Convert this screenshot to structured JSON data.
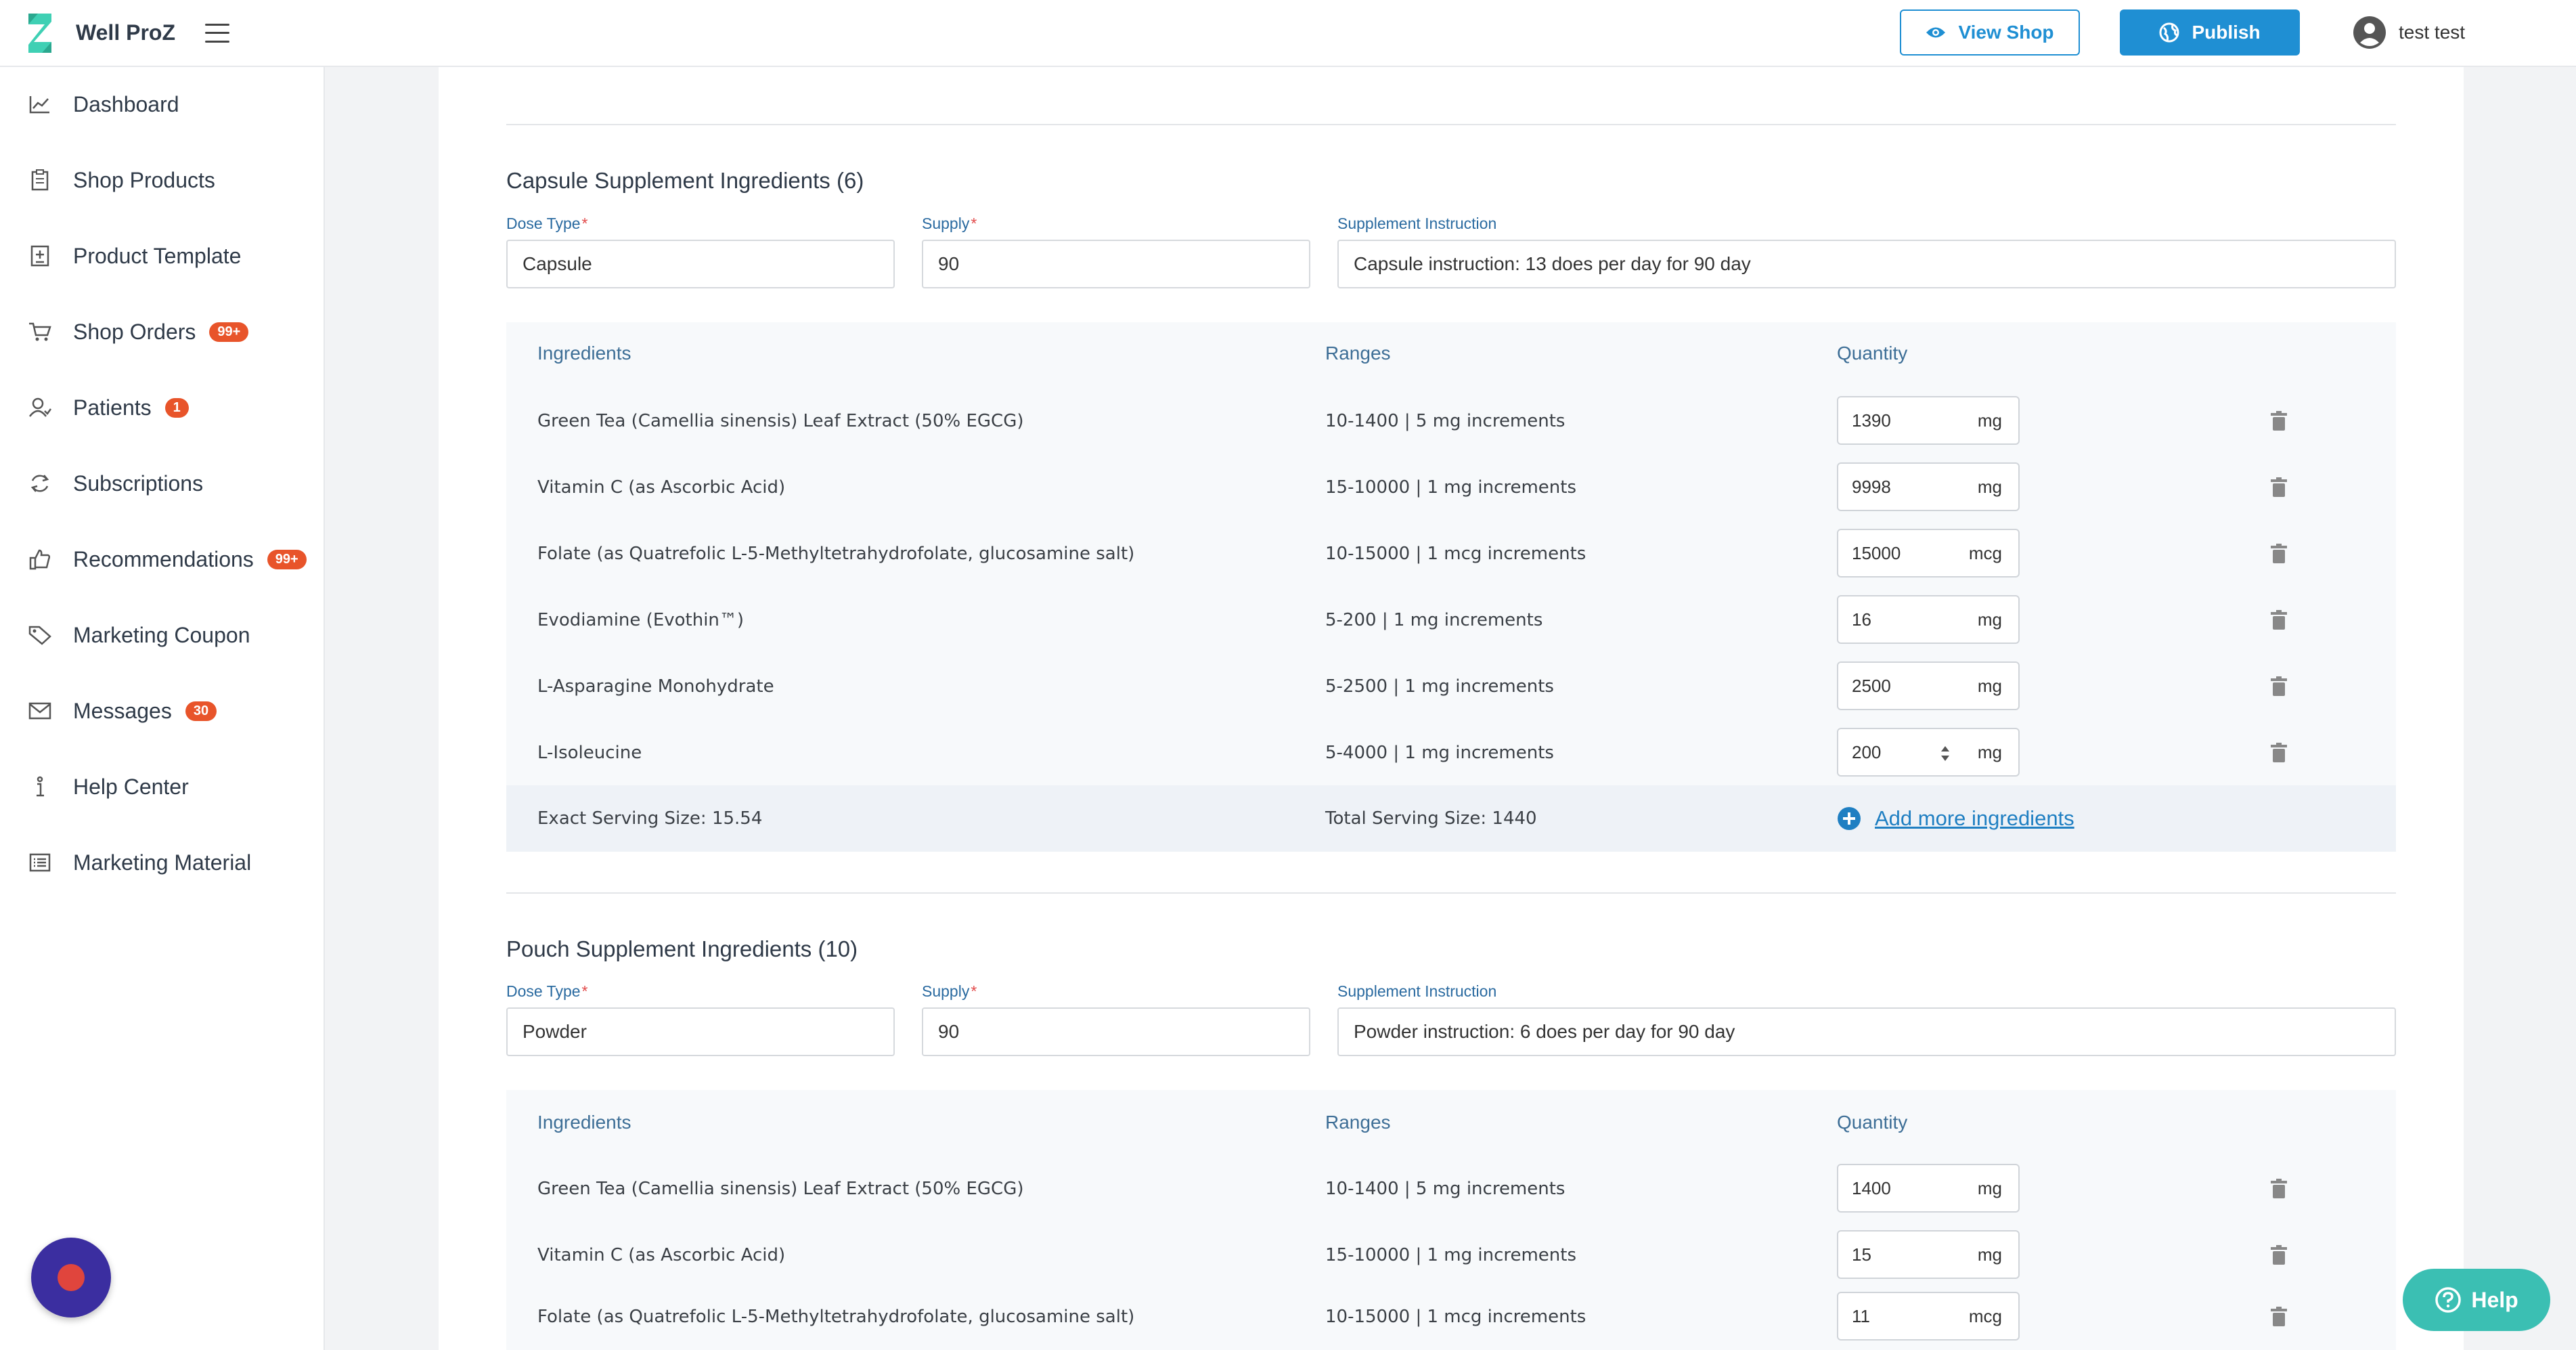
{
  "header": {
    "brand": "Well ProZ",
    "view_shop": "View Shop",
    "publish": "Publish",
    "user_name": "test test"
  },
  "sidebar": {
    "items": [
      {
        "label": "Dashboard",
        "icon": "chart-line-icon",
        "badge": ""
      },
      {
        "label": "Shop Products",
        "icon": "clipboard-icon",
        "badge": ""
      },
      {
        "label": "Product Template",
        "icon": "template-icon",
        "badge": ""
      },
      {
        "label": "Shop Orders",
        "icon": "cart-icon",
        "badge": "99+"
      },
      {
        "label": "Patients",
        "icon": "user-icon",
        "badge": "1"
      },
      {
        "label": "Subscriptions",
        "icon": "refresh-icon",
        "badge": ""
      },
      {
        "label": "Recommendations",
        "icon": "thumbs-up-icon",
        "badge": "99+"
      },
      {
        "label": "Marketing Coupon",
        "icon": "tag-icon",
        "badge": ""
      },
      {
        "label": "Messages",
        "icon": "mail-icon",
        "badge": "30"
      },
      {
        "label": "Help Center",
        "icon": "info-icon",
        "badge": ""
      },
      {
        "label": "Marketing Material",
        "icon": "list-icon",
        "badge": ""
      }
    ]
  },
  "capsule": {
    "title": "Capsule Supplement Ingredients (6)",
    "dose_type_label": "Dose Type",
    "dose_type_value": "Capsule",
    "supply_label": "Supply",
    "supply_value": "90",
    "instruction_label": "Supplement Instruction",
    "instruction_value": "Capsule instruction: 13 does per day for 90 day",
    "col_ingredients": "Ingredients",
    "col_ranges": "Ranges",
    "col_quantity": "Quantity",
    "rows": [
      {
        "name": "Green Tea (Camellia sinensis) Leaf Extract (50% EGCG)",
        "range": "10-1400 | 5 mg increments",
        "qty": "1390",
        "unit": "mg"
      },
      {
        "name": "Vitamin C (as Ascorbic Acid)",
        "range": "15-10000 | 1 mg increments",
        "qty": "9998",
        "unit": "mg"
      },
      {
        "name": "Folate (as Quatrefolic L-5-Methyltetrahydrofolate, glucosamine salt)",
        "range": "10-15000 | 1 mcg increments",
        "qty": "15000",
        "unit": "mcg"
      },
      {
        "name": "Evodiamine (Evothin™)",
        "range": "5-200 | 1 mg increments",
        "qty": "16",
        "unit": "mg"
      },
      {
        "name": "L-Asparagine Monohydrate",
        "range": "5-2500 | 1 mg increments",
        "qty": "2500",
        "unit": "mg"
      },
      {
        "name": "L-Isoleucine",
        "range": "5-4000 | 1 mg increments",
        "qty": "200",
        "unit": "mg"
      }
    ],
    "exact_serving": "Exact Serving Size: 15.54",
    "total_serving": "Total Serving Size: 1440",
    "add_more": "Add more ingredients"
  },
  "pouch": {
    "title": "Pouch Supplement Ingredients (10)",
    "dose_type_label": "Dose Type",
    "dose_type_value": "Powder",
    "supply_label": "Supply",
    "supply_value": "90",
    "instruction_label": "Supplement Instruction",
    "instruction_value": "Powder instruction: 6 does per day for 90 day",
    "col_ingredients": "Ingredients",
    "col_ranges": "Ranges",
    "col_quantity": "Quantity",
    "rows": [
      {
        "name": "Green Tea (Camellia sinensis) Leaf Extract (50% EGCG)",
        "range": "10-1400 | 5 mg increments",
        "qty": "1400",
        "unit": "mg"
      },
      {
        "name": "Vitamin C (as Ascorbic Acid)",
        "range": "15-10000 | 1 mg increments",
        "qty": "15",
        "unit": "mg"
      },
      {
        "name": "Folate (as Quatrefolic L-5-Methyltetrahydrofolate, glucosamine salt)",
        "range": "10-15000 | 1 mcg increments",
        "qty": "11",
        "unit": "mcg"
      }
    ]
  },
  "help_button": "Help",
  "colors": {
    "primary": "#1f8fd3",
    "badge": "#e8542a",
    "help": "#3bbfb3",
    "bubble": "#3b2ea0"
  }
}
